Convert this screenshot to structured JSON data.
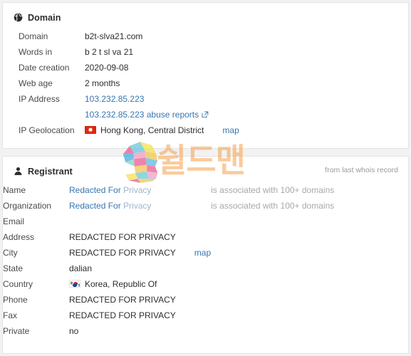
{
  "panels": {
    "domain": {
      "icon": "globe-icon",
      "title": "Domain",
      "rows": [
        {
          "label": "Domain",
          "value": "b2t-slva21.com",
          "type": "text"
        },
        {
          "label": "Words in",
          "value": "b 2 t sl va 21",
          "type": "text"
        },
        {
          "label": "Date creation",
          "value": "2020-09-08",
          "type": "text"
        },
        {
          "label": "Web age",
          "value": "2 months",
          "type": "text"
        },
        {
          "label": "IP Address",
          "value": "103.232.85.223",
          "type": "link"
        },
        {
          "label": "",
          "value": "103.232.85.223 abuse reports",
          "type": "link-external"
        },
        {
          "label": "IP Geolocation",
          "value": "Hong Kong, Central District",
          "type": "flag",
          "flag": "hk-flag-icon",
          "extra_link": "map"
        }
      ]
    },
    "registrant": {
      "icon": "user-icon",
      "title": "Registrant",
      "note": "from last whois record",
      "rows": [
        {
          "label": "Name",
          "value": "Redacted For",
          "value_soft": "Privacy",
          "extra": "is associated with 100+ domains",
          "type": "link-soft"
        },
        {
          "label": "Organization",
          "value": "Redacted For",
          "value_soft": "Privacy",
          "extra": "is associated with 100+ domains",
          "type": "link-soft"
        },
        {
          "label": "Email",
          "value": "",
          "type": "text"
        },
        {
          "label": "Address",
          "value": "REDACTED FOR PRIVACY",
          "type": "text"
        },
        {
          "label": "City",
          "value": "REDACTED FOR PRIVACY",
          "type": "text",
          "extra_link": "map"
        },
        {
          "label": "State",
          "value": "dalian",
          "type": "text"
        },
        {
          "label": "Country",
          "value": "Korea, Republic Of",
          "type": "flag",
          "flag": "kr-flag-icon"
        },
        {
          "label": "Phone",
          "value": "REDACTED FOR PRIVACY",
          "type": "text"
        },
        {
          "label": "Fax",
          "value": "REDACTED FOR PRIVACY",
          "type": "text"
        },
        {
          "label": "Private",
          "value": "no",
          "type": "text"
        }
      ]
    }
  },
  "watermark": {
    "logo_letter": "S",
    "text": "쉴드맨"
  },
  "colors": {
    "link": "#3676b0",
    "soft_link": "#9fb4cb",
    "muted": "#a8a8a8",
    "label": "#4a4a4a",
    "value": "#2d2d2d",
    "panel_bg": "#ffffff",
    "page_bg": "#f2f2f2",
    "border": "#e4e4e4",
    "watermark_text": "#f3983a",
    "hk_flag": "#de2910",
    "kr_red": "#cd2e3a",
    "kr_blue": "#0047a0"
  }
}
